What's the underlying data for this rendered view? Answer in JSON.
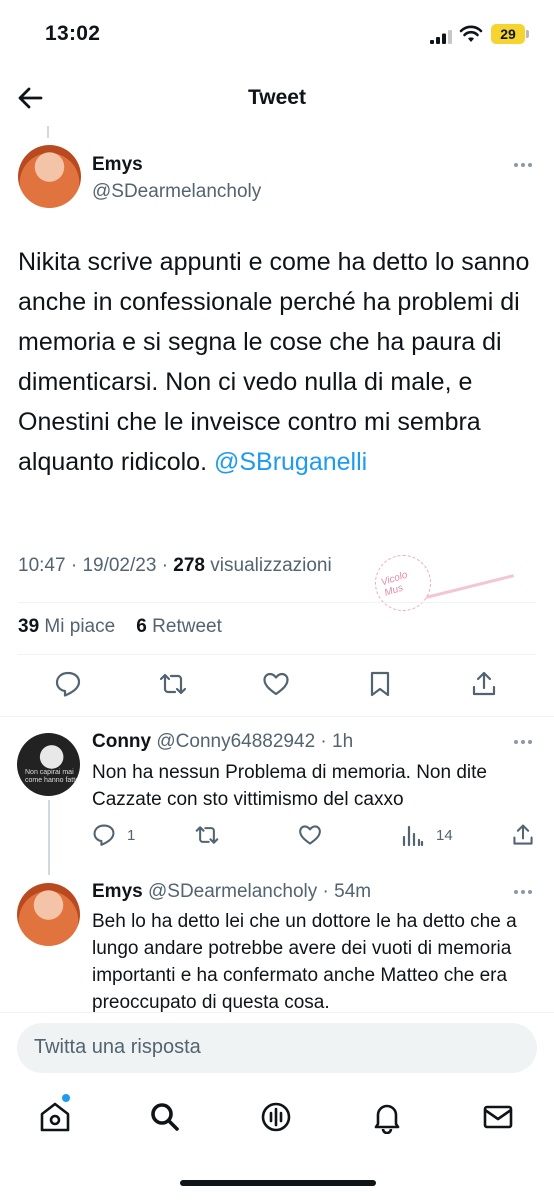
{
  "status_bar": {
    "time": "13:02",
    "battery": "29"
  },
  "header": {
    "title": "Tweet"
  },
  "tweet": {
    "author_name": "Emys",
    "author_handle": "@SDearmelancholy",
    "text": "Nikita scrive appunti e come ha detto lo sanno anche in confessionale perché ha problemi di memoria e si segna le cose che ha paura di dimenticarsi. Non ci vedo nulla di male, e Onestini che le inveisce contro mi sembra alquanto ridicolo.",
    "mention": "@SBruganelli",
    "time": "10:47",
    "date": "19/02/23",
    "views_count": "278",
    "views_label": "visualizzazioni",
    "likes_count": "39",
    "likes_label": "Mi piace",
    "retweets_count": "6",
    "retweets_label": "Retweet"
  },
  "watermark": {
    "text": "Vicolo Mus"
  },
  "replies": [
    {
      "name": "Conny",
      "handle": "@Conny64882942",
      "time": "· 1h",
      "text": "Non ha nessun Problema di memoria. Non dite Cazzate con sto vittimismo del caxxo",
      "reply_count": "1",
      "views_count": "14",
      "avatar_caption": "Non capirai mai come hanno fatto"
    },
    {
      "name": "Emys",
      "handle": "@SDearmelancholy",
      "time": "· 54m",
      "text": "Beh lo ha detto lei che un dottore le ha detto che a lungo andare potrebbe avere dei vuoti di memoria importanti e ha confermato anche Matteo che era preoccupato di questa cosa."
    }
  ],
  "compose": {
    "placeholder": "Twitta una risposta"
  },
  "icons": {
    "back": "arrow-left-icon",
    "more": "more-horizontal-icon",
    "reply": "reply-icon",
    "retweet": "retweet-icon",
    "like": "heart-icon",
    "bookmark": "bookmark-icon",
    "share": "share-icon",
    "views": "views-chart-icon",
    "tabs": [
      "home-icon",
      "search-icon",
      "spaces-icon",
      "bell-icon",
      "mail-icon"
    ]
  },
  "colors": {
    "accent": "#1d9bf0",
    "text": "#0f1419",
    "muted": "#536471",
    "battery": "#f5d431"
  }
}
